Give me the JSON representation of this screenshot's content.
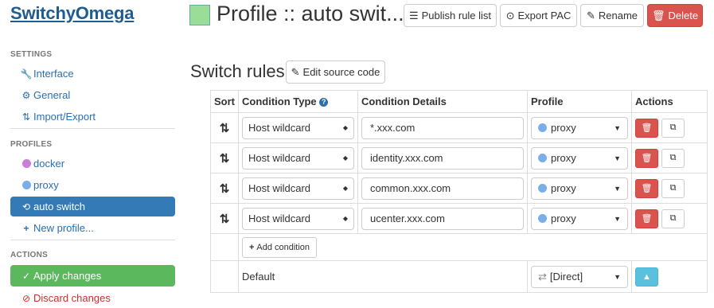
{
  "app": {
    "title": "SwitchyOmega"
  },
  "sidebar": {
    "settings_heading": "SETTINGS",
    "settings": [
      {
        "label": "Interface",
        "icon": "wrench-icon"
      },
      {
        "label": "General",
        "icon": "gear-icon"
      },
      {
        "label": "Import/Export",
        "icon": "import-export-icon"
      }
    ],
    "profiles_heading": "PROFILES",
    "profiles": [
      {
        "label": "docker",
        "icon": "circle-icon",
        "color": "#c97ed6"
      },
      {
        "label": "proxy",
        "icon": "circle-icon",
        "color": "#7aaee8"
      },
      {
        "label": "auto switch",
        "icon": "auto-switch-icon",
        "active": true
      },
      {
        "label": "New profile...",
        "icon": "plus-icon"
      }
    ],
    "actions_heading": "ACTIONS",
    "apply_label": "Apply changes",
    "discard_label": "Discard changes"
  },
  "header": {
    "profile_title": "Profile :: auto swit...",
    "swatch_color": "#99dd99",
    "publish_label": "Publish rule list",
    "export_label": "Export PAC",
    "rename_label": "Rename",
    "delete_label": "Delete"
  },
  "rules": {
    "title": "Switch rules",
    "edit_source_label": "Edit source code",
    "columns": {
      "sort": "Sort",
      "condition_type": "Condition Type",
      "condition_details": "Condition Details",
      "profile": "Profile",
      "actions": "Actions"
    },
    "rows": [
      {
        "type": "Host wildcard",
        "details": "*.xxx.com",
        "profile": "proxy"
      },
      {
        "type": "Host wildcard",
        "details": "identity.xxx.com",
        "profile": "proxy"
      },
      {
        "type": "Host wildcard",
        "details": "common.xxx.com",
        "profile": "proxy"
      },
      {
        "type": "Host wildcard",
        "details": "ucenter.xxx.com",
        "profile": "proxy"
      }
    ],
    "add_condition_label": "Add condition",
    "default_label": "Default",
    "default_profile": "[Direct]"
  },
  "colors": {
    "accent": "#337ab7",
    "danger": "#d9534f",
    "success": "#5cb85c",
    "info": "#5bc0de"
  }
}
